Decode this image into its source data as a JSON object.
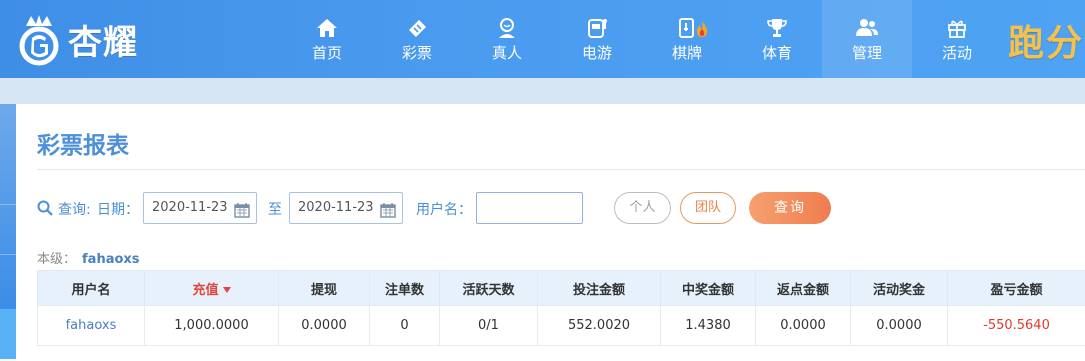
{
  "brand": {
    "name": "杏耀",
    "promo": "跑分"
  },
  "nav": {
    "items": [
      {
        "label": "首页",
        "icon": "home-icon"
      },
      {
        "label": "彩票",
        "icon": "lottery-ticket-icon"
      },
      {
        "label": "真人",
        "icon": "live-dealer-icon"
      },
      {
        "label": "电游",
        "icon": "slot-machine-icon"
      },
      {
        "label": "棋牌",
        "icon": "card-game-icon"
      },
      {
        "label": "体育",
        "icon": "trophy-icon"
      },
      {
        "label": "管理",
        "icon": "users-icon",
        "active": true
      },
      {
        "label": "活动",
        "icon": "gift-icon"
      }
    ]
  },
  "page": {
    "title": "彩票报表"
  },
  "filter": {
    "query_label": "查询:",
    "date_label": "日期：",
    "start_date": "2020-11-23",
    "to_label": "至",
    "end_date": "2020-11-23",
    "username_label": "用户名：",
    "username_value": "",
    "personal_label": "个人",
    "team_label": "团队",
    "search_label": "查询"
  },
  "level": {
    "label": "本级：",
    "user": "fahaoxs"
  },
  "table": {
    "columns": [
      "用户名",
      "充值",
      "提现",
      "注单数",
      "活跃天数",
      "投注金额",
      "中奖金额",
      "返点金额",
      "活动奖金",
      "盈亏金额"
    ],
    "rows": [
      [
        "fahaoxs",
        "1,000.0000",
        "0.0000",
        "0",
        "0/1",
        "552.0020",
        "1.4380",
        "0.0000",
        "0.0000",
        "-550.5640"
      ]
    ]
  },
  "colors": {
    "accent": "#4d8fd9",
    "negative": "#e03a2f",
    "query_button": "#ef7d4e"
  }
}
